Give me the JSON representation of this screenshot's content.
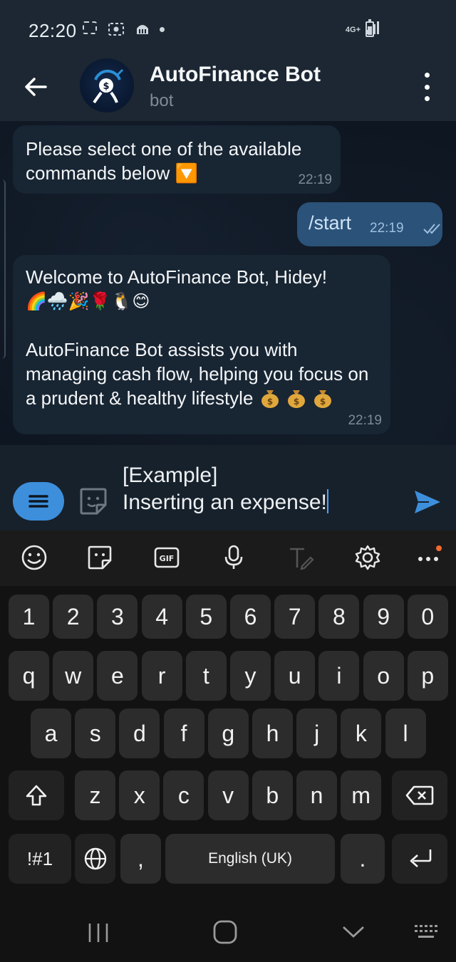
{
  "status_bar": {
    "time": "22:20",
    "network": "4G+"
  },
  "header": {
    "title": "AutoFinance Bot",
    "subtitle": "bot"
  },
  "messages": [
    {
      "direction": "incoming",
      "text": "Please select one of the available commands below 🔽",
      "time": "22:19"
    },
    {
      "direction": "outgoing",
      "text": "/start",
      "time": "22:19",
      "status": "read"
    },
    {
      "direction": "incoming",
      "line1": "Welcome to AutoFinance Bot, Hidey!",
      "emojis": "🌈🌧️🎉🌹🐧😊",
      "line2": "AutoFinance Bot assists you with managing cash flow, helping you focus on a prudent & healthy lifestyle",
      "time": "22:19"
    }
  ],
  "composer": {
    "input_value": "[Example]\nInserting an expense!"
  },
  "keyboard": {
    "row_numbers": [
      "1",
      "2",
      "3",
      "4",
      "5",
      "6",
      "7",
      "8",
      "9",
      "0"
    ],
    "row1": [
      "q",
      "w",
      "e",
      "r",
      "t",
      "y",
      "u",
      "i",
      "o",
      "p"
    ],
    "row2": [
      "a",
      "s",
      "d",
      "f",
      "g",
      "h",
      "j",
      "k",
      "l"
    ],
    "row3": [
      "z",
      "x",
      "c",
      "v",
      "b",
      "n",
      "m"
    ],
    "symbols_label": "!#1",
    "comma": ",",
    "space_label": "English (UK)",
    "period": "."
  },
  "colors": {
    "header_bg": "#1c2733",
    "chat_bg": "#0e1621",
    "incoming_bubble": "#182533",
    "outgoing_bubble": "#2b5278",
    "accent": "#3d8fdc"
  },
  "icons": [
    "back-arrow-icon",
    "more-vert-icon",
    "menu-icon",
    "sticker-icon",
    "send-icon",
    "emoji-icon",
    "gif-icon",
    "microphone-icon",
    "text-style-icon",
    "settings-icon",
    "more-horiz-icon",
    "shift-icon",
    "backspace-icon",
    "globe-icon",
    "enter-icon"
  ]
}
